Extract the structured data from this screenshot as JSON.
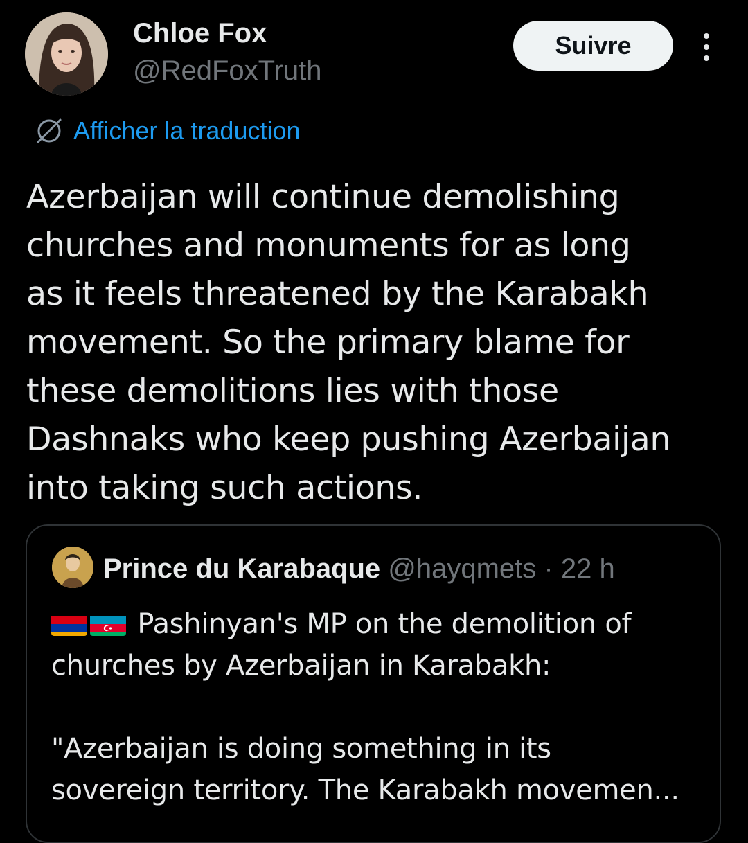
{
  "author": {
    "name": "Chloe Fox",
    "handle": "@RedFoxTruth",
    "avatar_icon": "profile-photo"
  },
  "actions": {
    "follow_label": "Suivre",
    "more_icon": "vertical-ellipsis-icon"
  },
  "translate": {
    "label": "Afficher la traduction",
    "icon": "globe-icon",
    "color": "#1d9bf0"
  },
  "tweet": {
    "lines": [
      "Azerbaijan will continue demolishing",
      "churches and monuments for as long",
      "as it feels threatened by the Karabakh",
      "movement. So the primary blame for",
      "these demolitions lies with those",
      "Dashnaks who keep pushing Azerbaijan",
      "into taking such actions."
    ]
  },
  "quote": {
    "author_name": "Prince du Karabaque",
    "handle": "@hayqmets",
    "separator": "·",
    "time": "22 h",
    "flags": [
      "armenia-flag",
      "azerbaijan-flag"
    ],
    "lines": [
      "Pashinyan's MP on the demolition of",
      "churches by Azerbaijan in Karabakh:",
      "",
      "\"Azerbaijan is doing something in its",
      "sovereign territory. The Karabakh movemen..."
    ]
  },
  "colors": {
    "background": "#000000",
    "text": "#e7e9ea",
    "secondary_text": "#71767b",
    "border": "#2f3336",
    "link": "#1d9bf0",
    "follow_button_bg": "#eff3f4"
  }
}
